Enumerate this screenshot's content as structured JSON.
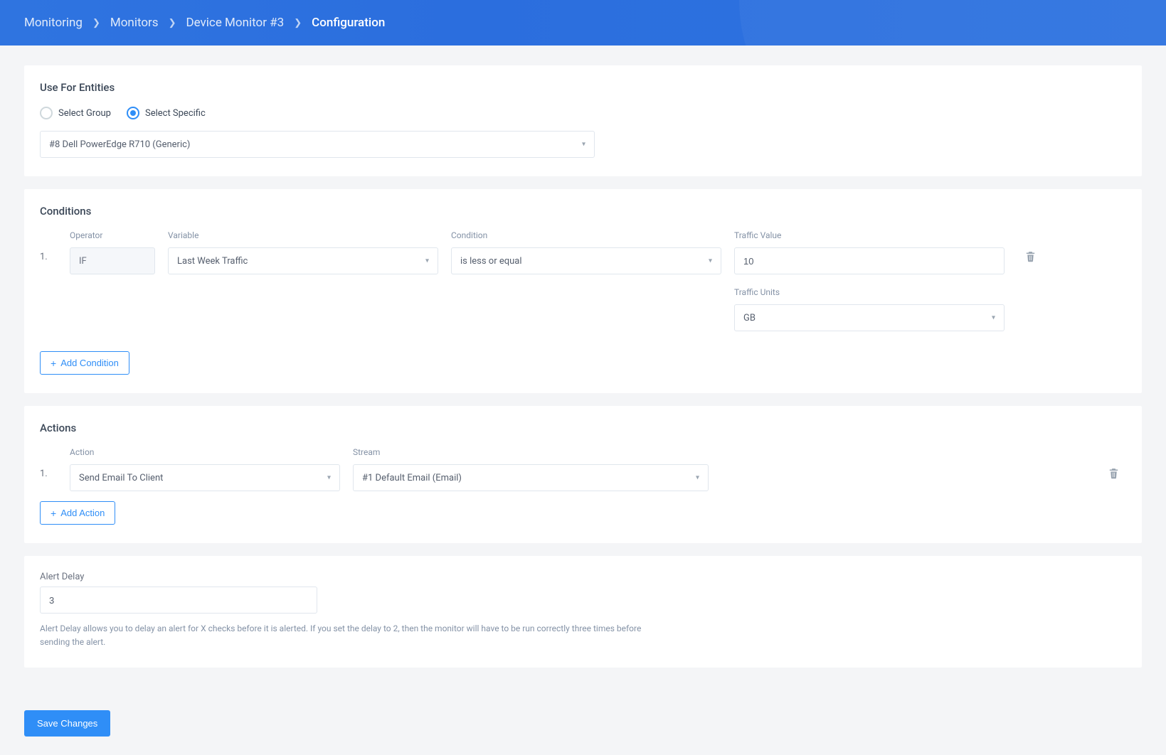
{
  "breadcrumb": {
    "items": [
      "Monitoring",
      "Monitors",
      "Device Monitor #3"
    ],
    "current": "Configuration"
  },
  "entities": {
    "section_title": "Use For Entities",
    "radio": {
      "group": "Select Group",
      "specific": "Select Specific",
      "selected": "specific"
    },
    "selected_entity": "#8 Dell PowerEdge R710 (Generic)"
  },
  "conditions": {
    "section_title": "Conditions",
    "labels": {
      "operator": "Operator",
      "variable": "Variable",
      "condition": "Condition",
      "traffic_value": "Traffic Value",
      "traffic_units": "Traffic Units"
    },
    "rows": [
      {
        "num": "1.",
        "operator": "IF",
        "variable": "Last Week Traffic",
        "condition": "is less or equal",
        "traffic_value": "10",
        "traffic_units": "GB"
      }
    ],
    "add_button": "Add Condition"
  },
  "actions": {
    "section_title": "Actions",
    "labels": {
      "action": "Action",
      "stream": "Stream"
    },
    "rows": [
      {
        "num": "1.",
        "action": "Send Email To Client",
        "stream": "#1 Default Email (Email)"
      }
    ],
    "add_button": "Add Action"
  },
  "alert_delay": {
    "label": "Alert Delay",
    "value": "3",
    "help": "Alert Delay allows you to delay an alert for X checks before it is alerted. If you set the delay to 2, then the monitor will have to be run correctly three times before sending the alert."
  },
  "footer": {
    "save": "Save Changes"
  }
}
